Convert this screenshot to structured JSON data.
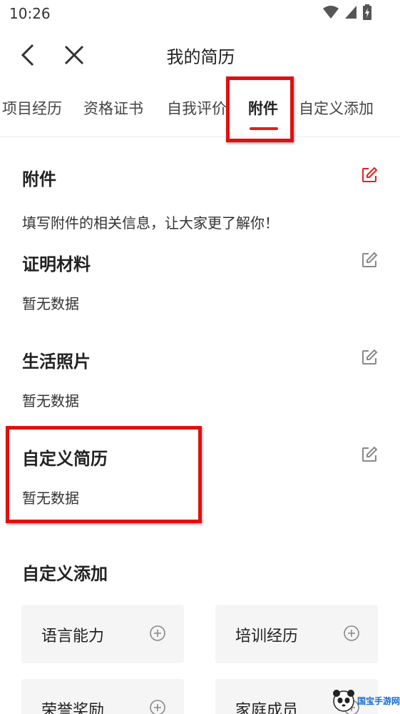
{
  "status_bar": {
    "time": "10:26"
  },
  "header": {
    "title": "我的简历"
  },
  "tabs": [
    {
      "label": "项目经历"
    },
    {
      "label": "资格证书"
    },
    {
      "label": "自我评价"
    },
    {
      "label": "附件"
    },
    {
      "label": "自定义添加"
    }
  ],
  "sections": {
    "attachment": {
      "title": "附件",
      "description": "填写附件的相关信息，让大家更了解你！"
    },
    "proof": {
      "title": "证明材料",
      "value": "暂无数据"
    },
    "photos": {
      "title": "生活照片",
      "value": "暂无数据"
    },
    "custom_resume": {
      "title": "自定义简历",
      "value": "暂无数据"
    }
  },
  "custom_add": {
    "title": "自定义添加",
    "items": [
      {
        "label": "语言能力"
      },
      {
        "label": "培训经历"
      },
      {
        "label": "荣誉奖励"
      },
      {
        "label": "家庭成员"
      }
    ]
  },
  "watermark": {
    "text": "国宝手游网"
  },
  "colors": {
    "accent": "#e02020",
    "highlight": "#e01010"
  }
}
